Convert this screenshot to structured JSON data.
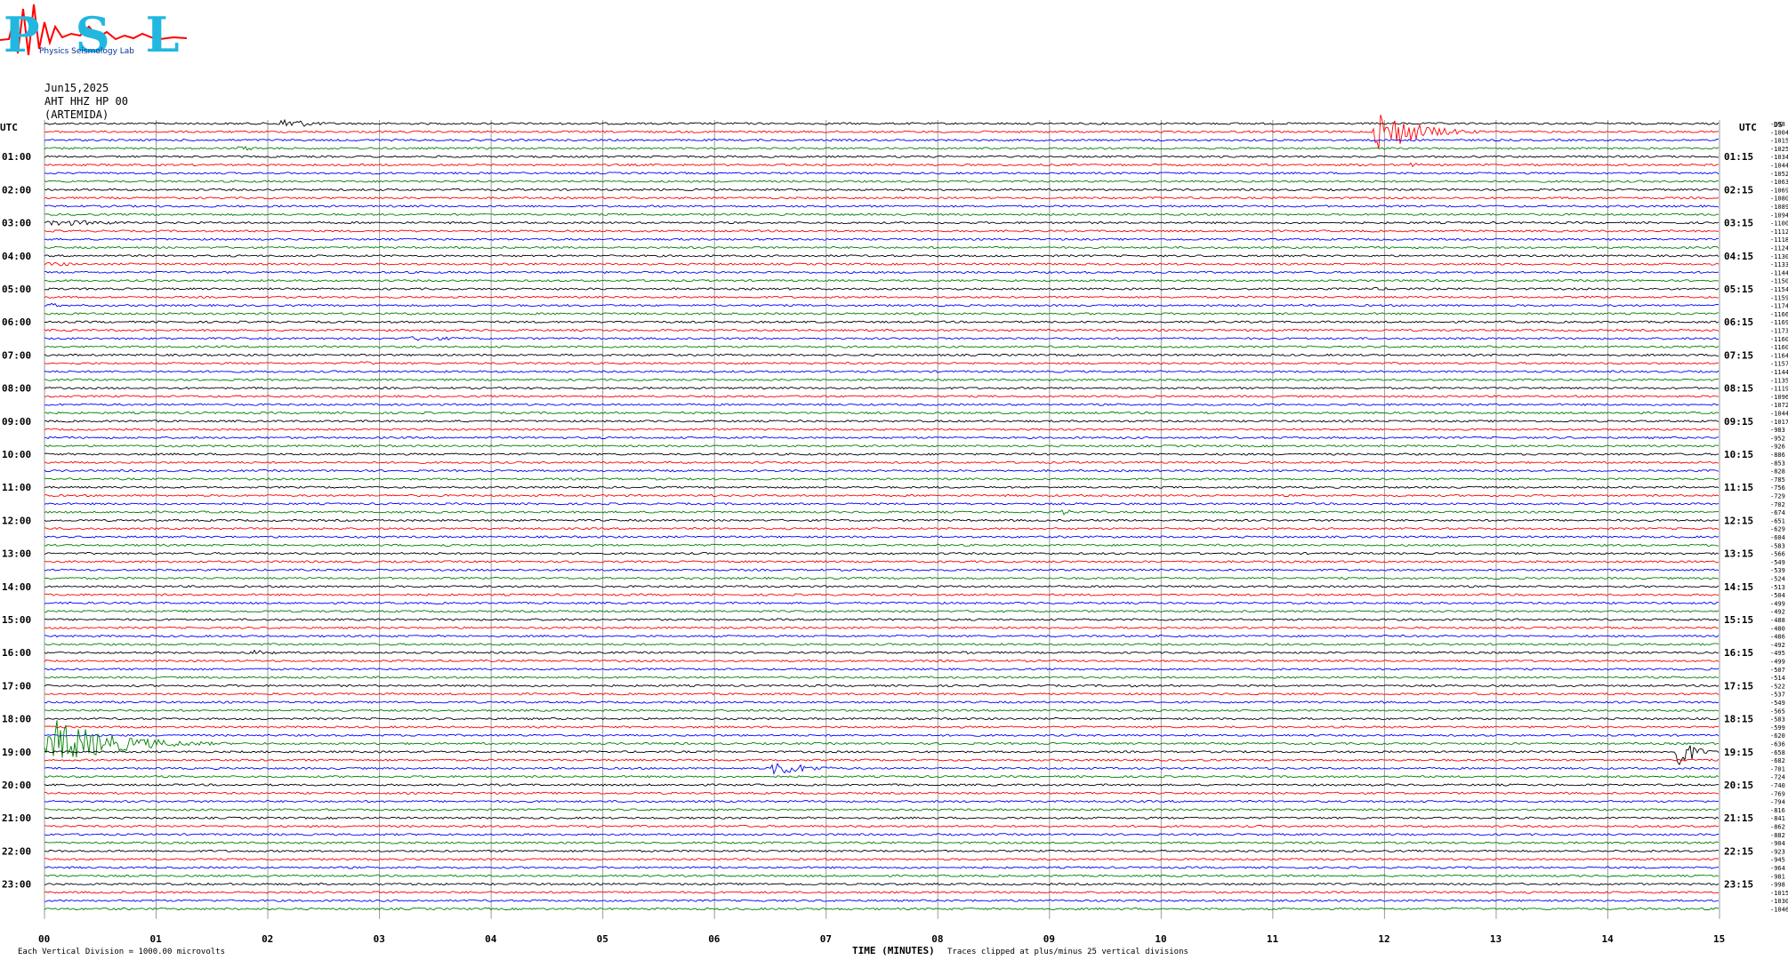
{
  "header": {
    "logo_text": "PSL",
    "logo_subtext": "Physics Seismology Lab",
    "date": "Jun15,2025",
    "station": "AHT HHZ HP 00",
    "place": "(ARTEMIDA)",
    "utc_left": "UTC",
    "utc_right": "UTC",
    "top_right_code": "DS"
  },
  "footer": {
    "left_mark": "",
    "scale_note": "Each Vertical Division = 1000.00 microvolts",
    "xlabel": "TIME (MINUTES)",
    "clip_note": "Traces clipped at plus/minus 25 vertical divisions"
  },
  "chart_data": {
    "type": "line",
    "subtype": "helicorder",
    "xlabel": "TIME (MINUTES)",
    "xlim": [
      0,
      15
    ],
    "x_ticks": [
      "00",
      "01",
      "02",
      "03",
      "04",
      "05",
      "06",
      "07",
      "08",
      "09",
      "10",
      "11",
      "12",
      "13",
      "14",
      "15"
    ],
    "rows": 96,
    "row_minutes": 15,
    "trace_colors": [
      "#000000",
      "#ff0000",
      "#0000ff",
      "#008000"
    ],
    "left_hour_labels": [
      "01:00",
      "02:00",
      "03:00",
      "04:00",
      "05:00",
      "06:00",
      "07:00",
      "08:00",
      "09:00",
      "10:00",
      "11:00",
      "12:00",
      "13:00",
      "14:00",
      "15:00",
      "16:00",
      "17:00",
      "18:00",
      "19:00",
      "20:00",
      "21:00",
      "22:00",
      "23:00"
    ],
    "right_hour_labels": [
      "01:15",
      "02:15",
      "03:15",
      "04:15",
      "05:15",
      "06:15",
      "07:15",
      "08:15",
      "09:15",
      "10:15",
      "11:15",
      "12:15",
      "13:15",
      "14:15",
      "15:15",
      "16:15",
      "17:15",
      "18:15",
      "19:15",
      "20:15",
      "21:15",
      "22:15",
      "23:15"
    ],
    "offsets": [
      998,
      1004,
      1015,
      1025,
      1034,
      1044,
      1052,
      1063,
      1069,
      1080,
      1089,
      1094,
      1100,
      1112,
      1118,
      1124,
      1130,
      1133,
      1144,
      1150,
      1154,
      1159,
      1174,
      1166,
      1169,
      1173,
      1160,
      1160,
      1164,
      1157,
      1144,
      1135,
      1119,
      1096,
      1072,
      1044,
      1017,
      983,
      952,
      926,
      886,
      853,
      828,
      785,
      756,
      729,
      702,
      674,
      651,
      629,
      604,
      583,
      566,
      549,
      539,
      524,
      513,
      504,
      499,
      492,
      488,
      480,
      486,
      492,
      495,
      499,
      507,
      514,
      522,
      537,
      549,
      565,
      583,
      599,
      620,
      636,
      658,
      682,
      701,
      724,
      740,
      769,
      794,
      816,
      841,
      862,
      882,
      904,
      923,
      945,
      964,
      981,
      998,
      1015,
      1030,
      1046
    ],
    "events": [
      {
        "row": 0,
        "start_min": 2.1,
        "end_min": 2.9,
        "peak": 8
      },
      {
        "row": 1,
        "start_min": 11.9,
        "end_min": 13.0,
        "peak": 28
      },
      {
        "row": 3,
        "start_min": 1.7,
        "end_min": 2.6,
        "peak": 3
      },
      {
        "row": 5,
        "start_min": 12.2,
        "end_min": 12.7,
        "peak": 3
      },
      {
        "row": 12,
        "start_min": 0.0,
        "end_min": 2.2,
        "peak": 4
      },
      {
        "row": 17,
        "start_min": 0.0,
        "end_min": 1.1,
        "peak": 3
      },
      {
        "row": 20,
        "start_min": 11.7,
        "end_min": 15.0,
        "peak": 2
      },
      {
        "row": 22,
        "start_min": 0.0,
        "end_min": 0.7,
        "peak": 3
      },
      {
        "row": 23,
        "start_min": 3.2,
        "end_min": 4.2,
        "peak": 2
      },
      {
        "row": 26,
        "start_min": 3.2,
        "end_min": 5.4,
        "peak": 3
      },
      {
        "row": 29,
        "start_min": 2.8,
        "end_min": 3.5,
        "peak": 3
      },
      {
        "row": 36,
        "start_min": 6.7,
        "end_min": 7.6,
        "peak": 2
      },
      {
        "row": 47,
        "start_min": 9.1,
        "end_min": 9.4,
        "peak": 5
      },
      {
        "row": 51,
        "start_min": 3.5,
        "end_min": 4.5,
        "peak": 2
      },
      {
        "row": 64,
        "start_min": 1.8,
        "end_min": 3.1,
        "peak": 3
      },
      {
        "row": 64,
        "start_min": 8.2,
        "end_min": 8.7,
        "peak": 3
      },
      {
        "row": 68,
        "start_min": 9.7,
        "end_min": 10.4,
        "peak": 2
      },
      {
        "row": 75,
        "start_min": 0.0,
        "end_min": 1.8,
        "peak": 30
      },
      {
        "row": 76,
        "start_min": 14.6,
        "end_min": 15.0,
        "peak": 28
      },
      {
        "row": 78,
        "start_min": 6.5,
        "end_min": 7.5,
        "peak": 10
      }
    ]
  }
}
